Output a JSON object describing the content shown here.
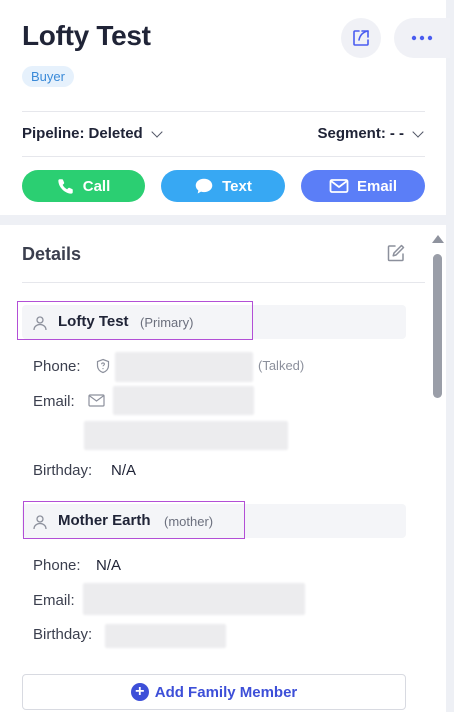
{
  "contact": {
    "name": "Lofty Test",
    "badge": "Buyer"
  },
  "filters": {
    "pipeline_label": "Pipeline:",
    "pipeline_value": "Deleted",
    "segment_label": "Segment:",
    "segment_value": "- -"
  },
  "actions": {
    "call": "Call",
    "text": "Text",
    "email": "Email"
  },
  "details": {
    "title": "Details",
    "primary": {
      "name": "Lofty Test",
      "role": "(Primary)",
      "phone_label": "Phone:",
      "phone_status": "(Talked)",
      "email_label": "Email:",
      "birthday_label": "Birthday:",
      "birthday_value": "N/A"
    },
    "family": {
      "name": "Mother Earth",
      "role": "(mother)",
      "phone_label": "Phone:",
      "phone_value": "N/A",
      "email_label": "Email:",
      "birthday_label": "Birthday:"
    },
    "add_member_label": "Add Family Member"
  },
  "icons": {
    "share": "share-icon",
    "more": "more-dots-icon",
    "call": "phone-icon",
    "text": "chat-bubble-icon",
    "email": "envelope-icon",
    "edit": "edit-icon",
    "person": "person-icon",
    "shield": "shield-question-icon",
    "plus": "plus-circle-icon"
  },
  "colors": {
    "call": "#2bcf72",
    "text": "#37a8f3",
    "email": "#5b7ef7",
    "accent": "#3d4fd8",
    "badge_bg": "#e6f1fc",
    "badge_text": "#3a8ad8",
    "highlight_box": "#b24fd6"
  }
}
